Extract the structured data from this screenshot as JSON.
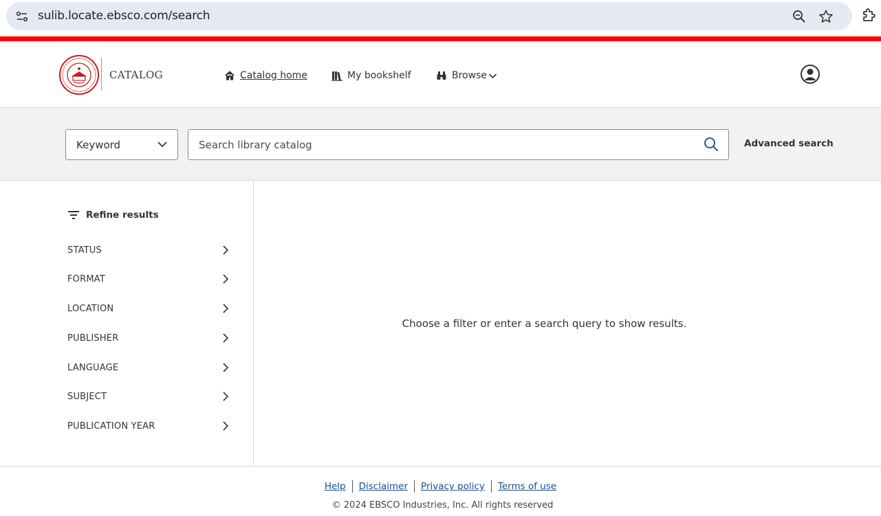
{
  "browser": {
    "url": "sulib.locate.ebsco.com/search"
  },
  "header": {
    "catalog_label": "CATALOG",
    "nav": {
      "home": "Catalog home",
      "bookshelf": "My bookshelf",
      "browse": "Browse"
    }
  },
  "search": {
    "type_selected": "Keyword",
    "placeholder": "Search library catalog",
    "advanced_label": "Advanced search"
  },
  "refine": {
    "heading": "Refine results",
    "facets": [
      "STATUS",
      "FORMAT",
      "LOCATION",
      "PUBLISHER",
      "LANGUAGE",
      "SUBJECT",
      "PUBLICATION YEAR"
    ]
  },
  "results": {
    "empty_message": "Choose a filter or enter a search query to show results."
  },
  "footer": {
    "links": [
      "Help",
      "Disclaimer",
      "Privacy policy",
      "Terms of use"
    ],
    "copyright": "© 2024 EBSCO Industries, Inc. All rights reserved"
  },
  "colors": {
    "brand_red": "#ff0000",
    "link_blue": "#1a4d8f",
    "search_icon_blue": "#2557a7"
  }
}
